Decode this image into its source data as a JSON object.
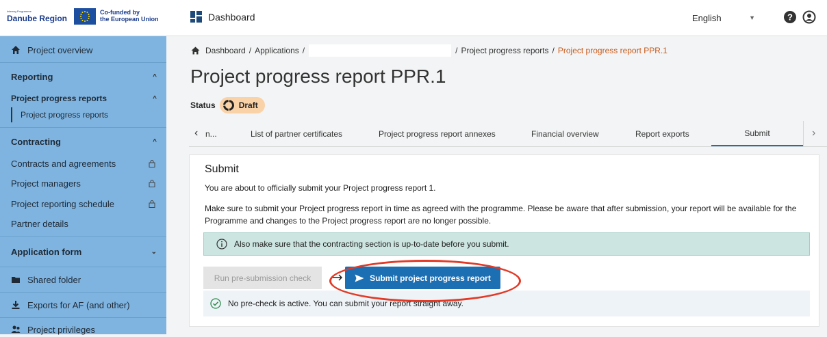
{
  "header": {
    "logo_small": "Interreg Programme",
    "logo_region": "Danube Region",
    "eu_line1": "Co-funded by",
    "eu_line2": "the European Union",
    "dashboard_label": "Dashboard",
    "language": "English"
  },
  "sidebar": {
    "project_overview": "Project overview",
    "reporting": "Reporting",
    "project_progress_reports": "Project progress reports",
    "project_progress_reports_sub": "Project progress reports",
    "contracting": "Contracting",
    "contracts_and_agreements": "Contracts and agreements",
    "project_managers": "Project managers",
    "project_reporting_schedule": "Project reporting schedule",
    "partner_details": "Partner details",
    "application_form": "Application form",
    "shared_folder": "Shared folder",
    "exports": "Exports for AF (and other)",
    "project_privileges": "Project privileges"
  },
  "breadcrumb": {
    "dashboard": "Dashboard",
    "sep1": "/",
    "applications": "Applications",
    "sep2": "/",
    "sep3": "/",
    "ppr": "Project progress reports",
    "sep4": "/",
    "current": "Project progress report PPR.1"
  },
  "page": {
    "title": "Project progress report PPR.1",
    "status_label": "Status",
    "status_value": "Draft"
  },
  "tabs": {
    "truncated": "n...",
    "partner_certificates": "List of partner certificates",
    "annexes": "Project progress report annexes",
    "financial": "Financial overview",
    "exports": "Report exports",
    "submit": "Submit"
  },
  "submit_card": {
    "title": "Submit",
    "intro": "You are about to officially submit your Project progress report 1.",
    "body": "Make sure to submit your Project progress report in time as agreed with the programme. Please be aware that after submission, your report will be available for the Programme and changes to the Project progress report are no longer possible.",
    "info": "Also make sure that the contracting section is up-to-date before you submit.",
    "precheck_button": "Run pre-submission check",
    "submit_button": "Submit project progress report",
    "precheck_message": "No pre-check is active. You can submit your report straight away."
  },
  "colors": {
    "sidebar_bg": "#7fb4e0",
    "primary": "#1d6fb3",
    "draft_badge": "#f9d2a8",
    "breadcrumb_current": "#c75a1a",
    "highlight_ring": "#e23a26",
    "info_box": "#cce5e0"
  }
}
